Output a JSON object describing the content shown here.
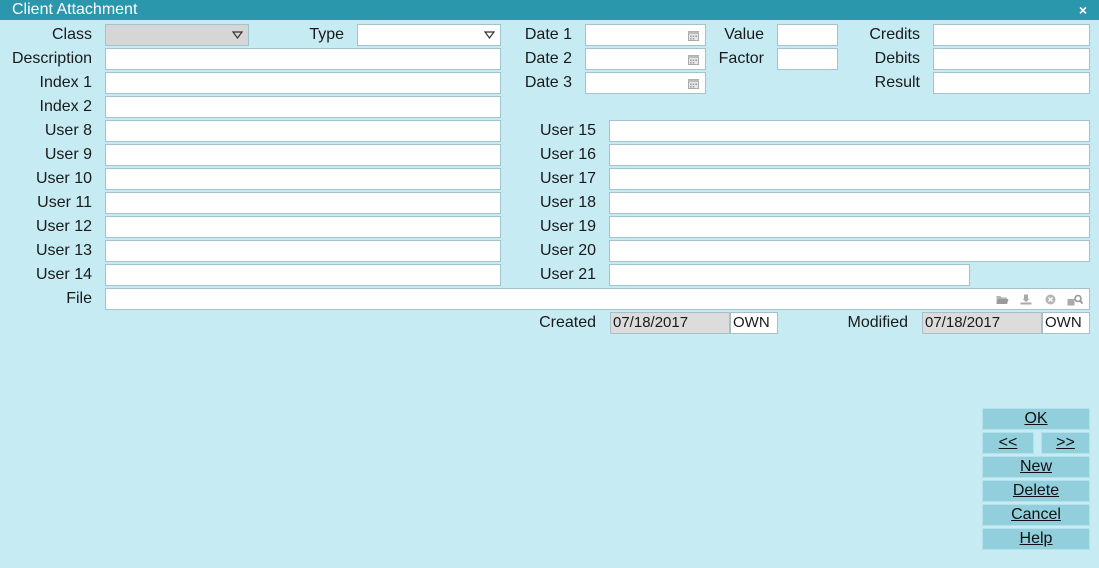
{
  "window": {
    "title": "Client Attachment",
    "close_glyph": "×"
  },
  "labels": {
    "class": "Class",
    "type": "Type",
    "description": "Description",
    "index1": "Index 1",
    "index2": "Index 2",
    "date1": "Date 1",
    "date2": "Date 2",
    "date3": "Date 3",
    "value": "Value",
    "factor": "Factor",
    "credits": "Credits",
    "debits": "Debits",
    "result": "Result",
    "user8": "User 8",
    "user9": "User 9",
    "user10": "User 10",
    "user11": "User 11",
    "user12": "User 12",
    "user13": "User 13",
    "user14": "User 14",
    "user15": "User 15",
    "user16": "User 16",
    "user17": "User 17",
    "user18": "User 18",
    "user19": "User 19",
    "user20": "User 20",
    "user21": "User 21",
    "file": "File",
    "created": "Created",
    "modified": "Modified"
  },
  "values": {
    "class": "",
    "type": "",
    "description": "",
    "index1": "",
    "index2": "",
    "date1": "",
    "date2": "",
    "date3": "",
    "value": "",
    "factor": "",
    "credits": "",
    "debits": "",
    "result": "",
    "user8": "",
    "user9": "",
    "user10": "",
    "user11": "",
    "user12": "",
    "user13": "",
    "user14": "",
    "user15": "",
    "user16": "",
    "user17": "",
    "user18": "",
    "user19": "",
    "user20": "",
    "user21": "",
    "file": "",
    "created_date": "07/18/2017",
    "created_by": "OWN",
    "modified_date": "07/18/2017",
    "modified_by": "OWN"
  },
  "buttons": {
    "ok": "OK",
    "prev": "<<",
    "next": ">>",
    "new": "New",
    "delete": "Delete",
    "cancel": "Cancel",
    "help": "Help"
  },
  "icons": {
    "dropdown": "chevron-down-icon",
    "calendar": "calendar-icon",
    "file_open": "folder-open-icon",
    "file_save": "save-icon",
    "file_clear": "clear-icon",
    "file_view": "view-file-icon"
  },
  "colors": {
    "background": "#c6ebf3",
    "titlebar": "#2b97ad",
    "button": "#92cfdc",
    "field_border": "#9fc4ce",
    "readonly": "#dcdcdc"
  }
}
